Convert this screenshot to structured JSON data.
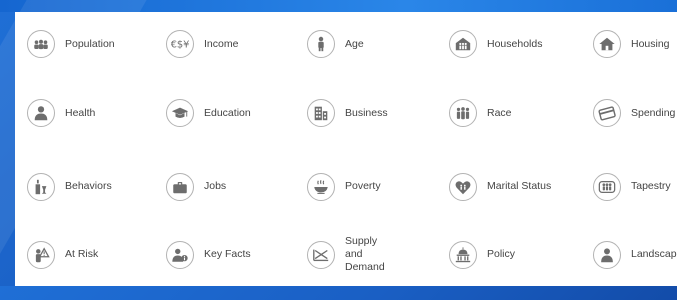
{
  "colors": {
    "background": "#1a5fc4",
    "panel": "#ffffff",
    "icon": "#6d6d6d",
    "icon_ring": "#b3b3b3",
    "label": "#444444"
  },
  "tiles": [
    {
      "label": "Population",
      "icon": "people-group-icon"
    },
    {
      "label": "Income",
      "icon": "currency-icon"
    },
    {
      "label": "Age",
      "icon": "person-icon"
    },
    {
      "label": "Households",
      "icon": "family-house-icon"
    },
    {
      "label": "Housing",
      "icon": "house-icon"
    },
    {
      "label": "Health",
      "icon": "health-person-icon"
    },
    {
      "label": "Education",
      "icon": "graduation-cap-icon"
    },
    {
      "label": "Business",
      "icon": "buildings-icon"
    },
    {
      "label": "Race",
      "icon": "people-diverse-icon"
    },
    {
      "label": "Spending",
      "icon": "credit-card-icon"
    },
    {
      "label": "Behaviors",
      "icon": "bottle-glass-icon"
    },
    {
      "label": "Jobs",
      "icon": "briefcase-icon"
    },
    {
      "label": "Poverty",
      "icon": "empty-bowl-icon"
    },
    {
      "label": "Marital Status",
      "icon": "heart-icon"
    },
    {
      "label": "Tapestry",
      "icon": "people-segments-icon"
    },
    {
      "label": "At Risk",
      "icon": "person-warning-icon"
    },
    {
      "label": "Key Facts",
      "icon": "person-info-icon"
    },
    {
      "label": "Supply and Demand",
      "icon": "supply-demand-icon"
    },
    {
      "label": "Policy",
      "icon": "capitol-icon"
    },
    {
      "label": "Landscape",
      "icon": "landscape-person-icon"
    }
  ]
}
